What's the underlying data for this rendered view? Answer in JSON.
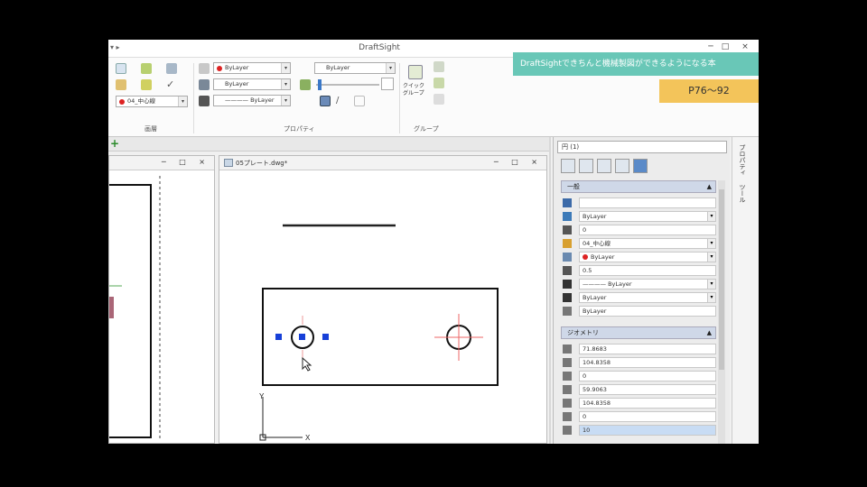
{
  "window": {
    "title": "DraftSight",
    "quick_access": "▾ ▸",
    "min": "─",
    "max": "□",
    "close": "×"
  },
  "ribbon": {
    "group_labels": [
      "画層",
      "プロパティ",
      "グループ"
    ],
    "layer_combo": "04_中心線",
    "color_combo": "ByLayer",
    "layer2_combo": "ByLayer",
    "linetype_combo": "———— ByLayer",
    "lineweight_combo": "ByLayer",
    "quick_group": "クイック\nグループ"
  },
  "banner": "DraftSightできちんと機械製図ができるようになる本",
  "pages": "P76〜92",
  "tabs": {
    "plus": "+"
  },
  "left_window": {
    "btns": "─ □ ×"
  },
  "main_window": {
    "tab": "05プレート.dwg*",
    "btns": "─ □ ×"
  },
  "axis": {
    "x": "X",
    "y": "Y"
  },
  "properties": {
    "selector": "円 (1)",
    "general_title": "一般",
    "general_rows": [
      {
        "icon": "globe-icon",
        "value": "",
        "color": "#3c6aa8"
      },
      {
        "icon": "layer-icon",
        "value": "ByLayer",
        "color": "#3c7ab8",
        "dd": true
      },
      {
        "icon": "thickness-icon",
        "value": "0",
        "color": "#555"
      },
      {
        "icon": "layer-folder-icon",
        "value": "04_中心線",
        "color": "#d8a030",
        "dd": true
      },
      {
        "icon": "color-icon",
        "value": "ByLayer",
        "color": "#6a8ab0",
        "dd": true,
        "dot": true
      },
      {
        "icon": "scale-icon",
        "value": "0.5",
        "color": "#555"
      },
      {
        "icon": "linetype-icon",
        "value": "———— ByLayer",
        "color": "#333",
        "dd": true
      },
      {
        "icon": "lineweight-icon",
        "value": "ByLayer",
        "color": "#333",
        "dd": true
      },
      {
        "icon": "transparency-icon",
        "value": "ByLayer",
        "color": "#777"
      }
    ],
    "geometry_title": "ジオメトリ",
    "geometry_rows": [
      {
        "value": "71.8683"
      },
      {
        "value": "104.8358"
      },
      {
        "value": "0"
      },
      {
        "value": "59.9063"
      },
      {
        "value": "104.8358"
      },
      {
        "value": "0"
      },
      {
        "value": "10",
        "hl": true
      }
    ],
    "collapse": "▲"
  },
  "side_tabs": [
    "プロパティ",
    "ツール"
  ]
}
